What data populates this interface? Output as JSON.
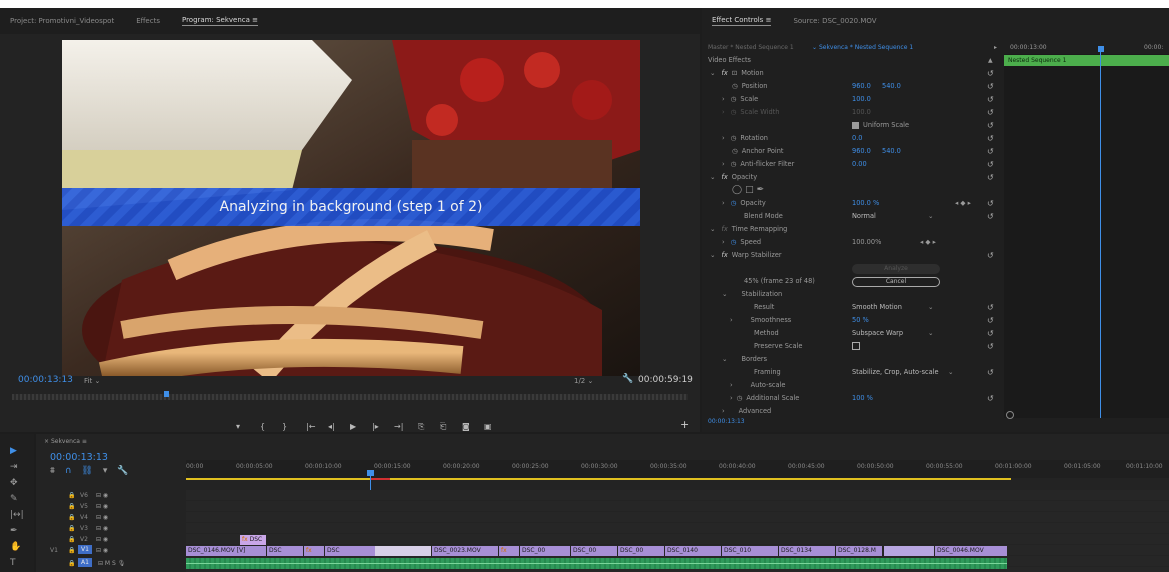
{
  "program_panel": {
    "tabs": [
      "Project: Promotivni_Videospot",
      "Effects",
      "Program: Sekvenca",
      "≡"
    ],
    "analyzing_text": "Analyzing in background (step 1 of 2)",
    "timecode_current": "00:00:13:13",
    "fit": "Fit",
    "resolution": "1/2",
    "timecode_duration": "00:00:59:19"
  },
  "effect_controls": {
    "tabs": [
      "Effect Controls",
      "≡",
      "Source: DSC_0020.MOV"
    ],
    "sequence_master": "Master * Nested Sequence 1",
    "sequence_active": "Sekvenca * Nested Sequence 1",
    "time_label": "00:00:13:00",
    "time_label_right": "00:00:",
    "nested_clip": "Nested Sequence 1",
    "section_video_effects": "Video Effects",
    "motion": "Motion",
    "position_label": "Position",
    "position_x": "960.0",
    "position_y": "540.0",
    "scale_label": "Scale",
    "scale_value": "100.0",
    "scale_width_label": "Scale Width",
    "scale_width_value": "100.0",
    "uniform_scale": "Uniform Scale",
    "rotation_label": "Rotation",
    "rotation_value": "0.0",
    "anchor_label": "Anchor Point",
    "anchor_x": "960.0",
    "anchor_y": "540.0",
    "antiflicker_label": "Anti-flicker Filter",
    "antiflicker_value": "0.00",
    "opacity_section": "Opacity",
    "opacity_label": "Opacity",
    "opacity_value": "100.0 %",
    "blend_label": "Blend Mode",
    "blend_value": "Normal",
    "time_remap": "Time Remapping",
    "speed_label": "Speed",
    "speed_value": "100.00%",
    "warp": "Warp Stabilizer",
    "analyze_button": "Analyze",
    "progress_text": "45% (frame 23 of 48)",
    "cancel_button": "Cancel",
    "stabilization": "Stabilization",
    "result_label": "Result",
    "result_value": "Smooth Motion",
    "smoothness_label": "Smoothness",
    "smoothness_value": "50 %",
    "method_label": "Method",
    "method_value": "Subspace Warp",
    "preserve_label": "Preserve Scale",
    "borders": "Borders",
    "framing_label": "Framing",
    "framing_value": "Stabilize, Crop, Auto-scale",
    "autoscale": "Auto-scale",
    "add_scale_label": "Additional Scale",
    "add_scale_value": "100 %",
    "advanced": "Advanced",
    "footer_time": "00:00:13:13"
  },
  "timeline": {
    "tab": "Sekvenca",
    "timecode": "00:00:13:13",
    "ruler": [
      "00:00",
      "00:00:05:00",
      "00:00:10:00",
      "00:00:15:00",
      "00:00:20:00",
      "00:00:25:00",
      "00:00:30:00",
      "00:00:35:00",
      "00:00:40:00",
      "00:00:45:00",
      "00:00:50:00",
      "00:00:55:00",
      "00:01:00:00",
      "00:01:05:00",
      "00:01:10:00"
    ],
    "tracks": [
      "V6",
      "V5",
      "V4",
      "V3",
      "V2",
      "V1",
      "A1"
    ],
    "track_v1_src": "V1",
    "v2_clip": "DSC",
    "clips": [
      "DSC_0146.MOV [V]",
      "DSC",
      "fx",
      "DSC",
      "DSC_0023.MOV",
      "fx",
      "DSC_00",
      "DSC_00",
      "DSC_00",
      "DSC_0140",
      "DSC_010",
      "DSC_0134",
      "DSC_0128.M",
      "DSC_0046.MOV"
    ]
  },
  "colors": {
    "accent_blue": "#3f8fe8",
    "clip_purple": "#a78fd6",
    "clip_pink": "#e08fd0",
    "green_bar": "#4cae4c",
    "audio_green": "#2f9a5b"
  }
}
